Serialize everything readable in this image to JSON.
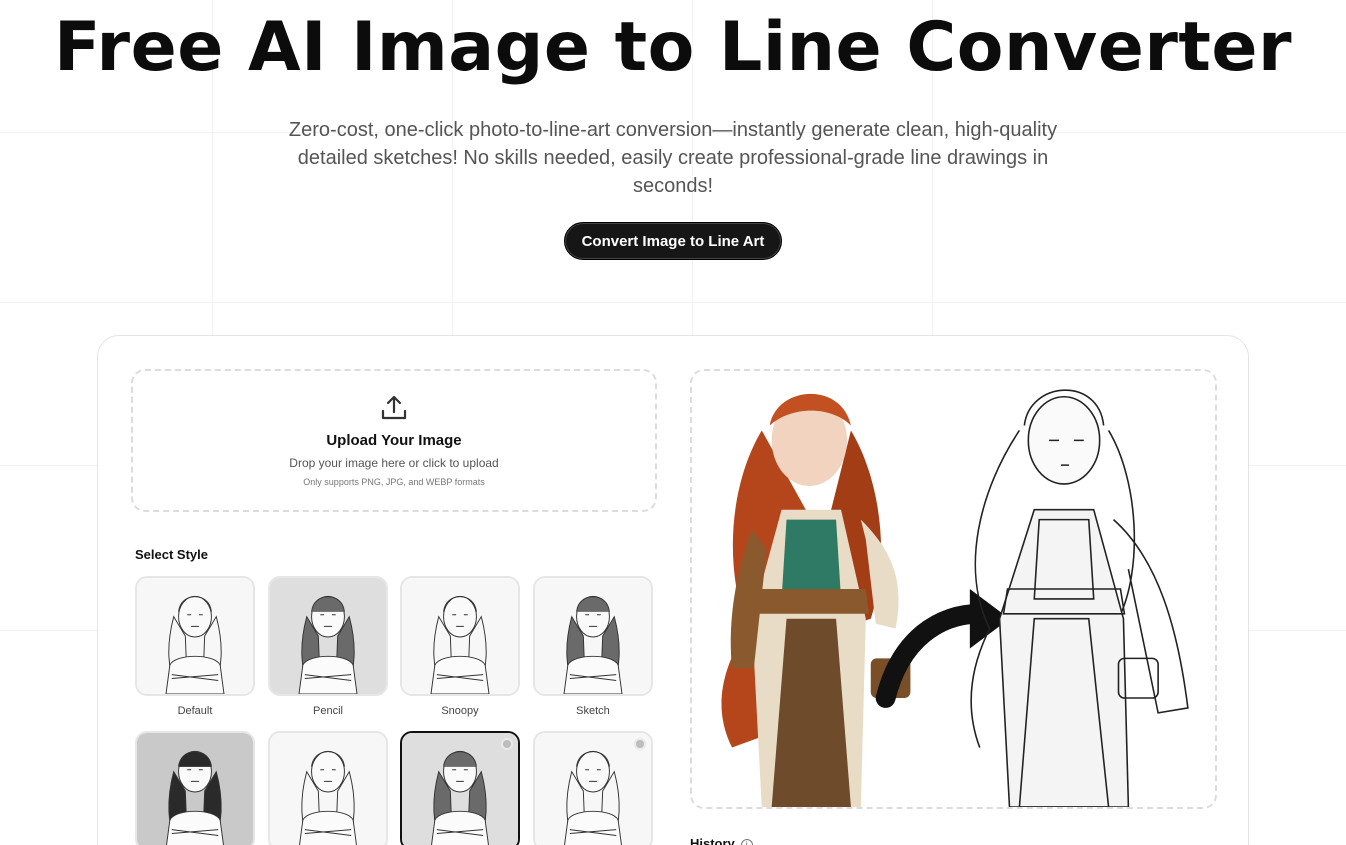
{
  "hero": {
    "title": "Free AI Image to Line Converter",
    "subtitle": "Zero-cost, one-click photo-to-line-art conversion—instantly generate clean, high-quality detailed sketches! No skills needed, easily create professional-grade line drawings in seconds!",
    "cta_label": "Convert Image to Line Art"
  },
  "upload": {
    "icon": "upload-icon",
    "title": "Upload Your Image",
    "subtitle": "Drop your image here or click to upload",
    "note": "Only supports PNG, JPG, and WEBP formats"
  },
  "styles": {
    "title": "Select Style",
    "items": [
      {
        "label": "Default",
        "selected": false,
        "badge": false
      },
      {
        "label": "Pencil",
        "selected": false,
        "badge": false
      },
      {
        "label": "Snoopy",
        "selected": false,
        "badge": false
      },
      {
        "label": "Sketch",
        "selected": false,
        "badge": false
      },
      {
        "label": "",
        "selected": false,
        "badge": false
      },
      {
        "label": "",
        "selected": false,
        "badge": false
      },
      {
        "label": "",
        "selected": true,
        "badge": true
      },
      {
        "label": "",
        "selected": false,
        "badge": true
      }
    ]
  },
  "history": {
    "title": "History",
    "icon": "info-icon"
  },
  "colors": {
    "button_bg": "#161616",
    "hair": "#b5461c",
    "dress_green": "#2f7a64"
  }
}
